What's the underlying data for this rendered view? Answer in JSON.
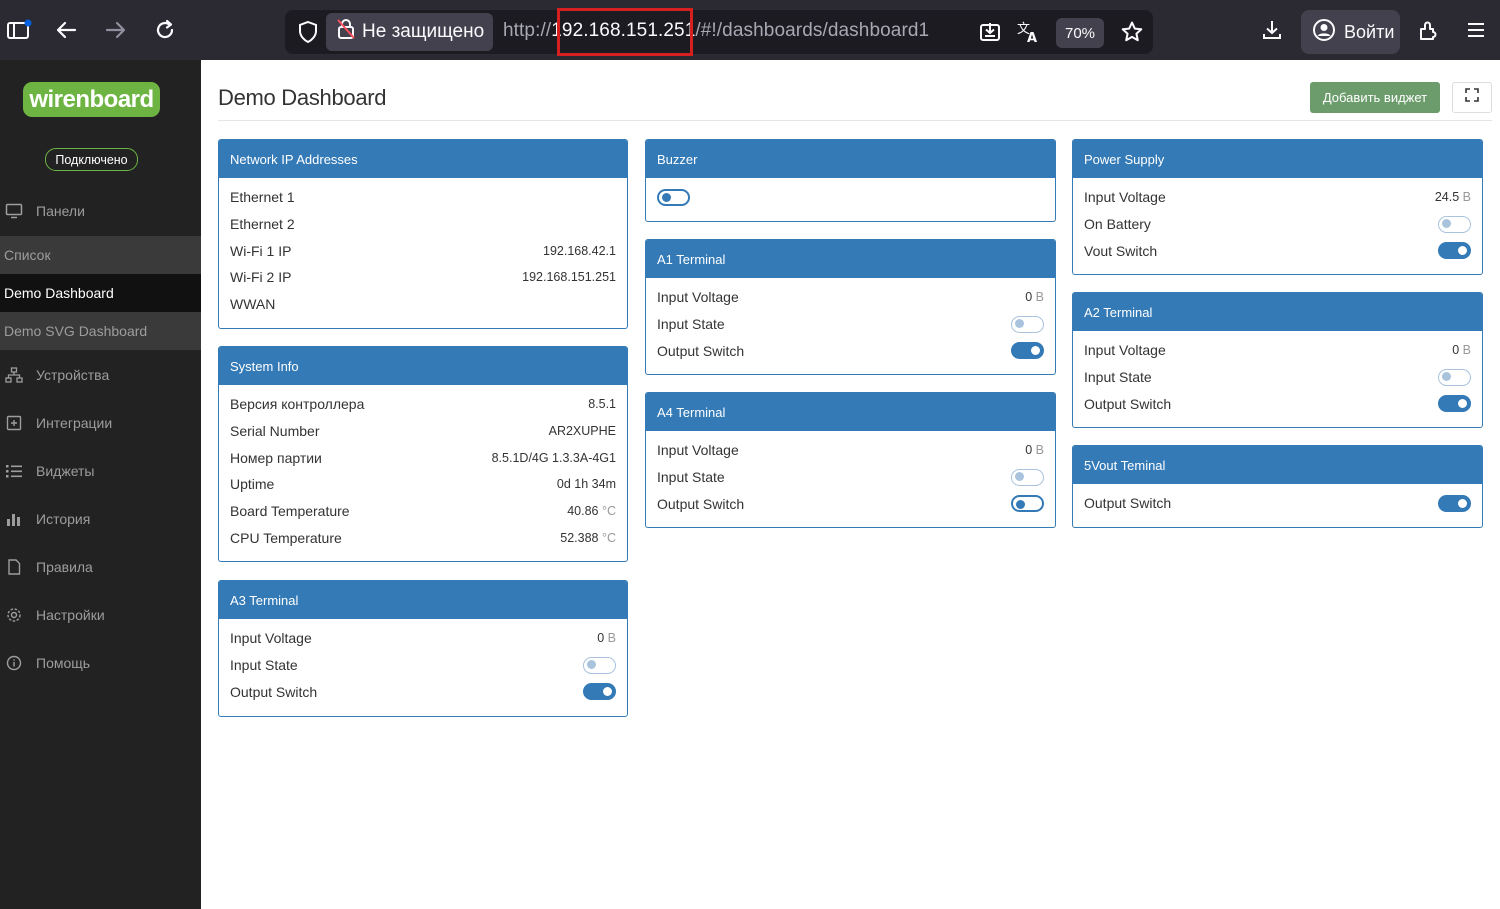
{
  "browser": {
    "security_label": "Не защищено",
    "url_prefix": "http://",
    "url_host": "192.168.151.251",
    "url_path": "/#!/dashboards/dashboard1",
    "zoom": "70%",
    "login_label": "Войти"
  },
  "sidebar": {
    "logo": "wirenboard",
    "status": "Подключено",
    "panels_label": "Панели",
    "sub_items": [
      "Список",
      "Demo Dashboard",
      "Demo SVG Dashboard"
    ],
    "items": [
      {
        "label": "Устройства",
        "icon": "devices-icon"
      },
      {
        "label": "Интеграции",
        "icon": "integrations-icon"
      },
      {
        "label": "Виджеты",
        "icon": "list-icon"
      },
      {
        "label": "История",
        "icon": "bar-chart-icon"
      },
      {
        "label": "Правила",
        "icon": "document-icon"
      },
      {
        "label": "Настройки",
        "icon": "gear-icon"
      },
      {
        "label": "Помощь",
        "icon": "info-icon"
      }
    ]
  },
  "main": {
    "title": "Demo Dashboard",
    "add_widget": "Добавить виджет"
  },
  "widgets": {
    "network": {
      "title": "Network IP Addresses",
      "rows": [
        {
          "label": "Ethernet 1",
          "value": ""
        },
        {
          "label": "Ethernet 2",
          "value": ""
        },
        {
          "label": "Wi-Fi 1 IP",
          "value": "192.168.42.1"
        },
        {
          "label": "Wi-Fi 2 IP",
          "value": "192.168.151.251"
        },
        {
          "label": "WWAN",
          "value": ""
        }
      ]
    },
    "system": {
      "title": "System Info",
      "rows": [
        {
          "label": "Версия контроллера",
          "value": "8.5.1",
          "unit": ""
        },
        {
          "label": "Serial Number",
          "value": "AR2XUPHE",
          "unit": ""
        },
        {
          "label": "Номер партии",
          "value": "8.5.1D/4G 1.3.3A-4G1",
          "unit": ""
        },
        {
          "label": "Uptime",
          "value": "0d 1h 34m",
          "unit": ""
        },
        {
          "label": "Board Temperature",
          "value": "40.86",
          "unit": "°C"
        },
        {
          "label": "CPU Temperature",
          "value": "52.388",
          "unit": "°C"
        }
      ]
    },
    "a3": {
      "title": "A3 Terminal",
      "voltage_label": "Input Voltage",
      "voltage": "0",
      "unit": "B",
      "state_label": "Input State",
      "state_on": false,
      "switch_label": "Output Switch",
      "switch_on": true
    },
    "buzzer": {
      "title": "Buzzer",
      "on": false
    },
    "a1": {
      "title": "A1 Terminal",
      "voltage_label": "Input Voltage",
      "voltage": "0",
      "unit": "B",
      "state_label": "Input State",
      "state_on": false,
      "switch_label": "Output Switch",
      "switch_on": true
    },
    "a4": {
      "title": "A4 Terminal",
      "voltage_label": "Input Voltage",
      "voltage": "0",
      "unit": "B",
      "state_label": "Input State",
      "state_on": false,
      "switch_label": "Output Switch",
      "switch_on": false
    },
    "power": {
      "title": "Power Supply",
      "voltage_label": "Input Voltage",
      "voltage": "24.5",
      "unit": "B",
      "battery_label": "On Battery",
      "battery_on": false,
      "vout_label": "Vout Switch",
      "vout_on": true
    },
    "a2": {
      "title": "A2 Terminal",
      "voltage_label": "Input Voltage",
      "voltage": "0",
      "unit": "B",
      "state_label": "Input State",
      "state_on": false,
      "switch_label": "Output Switch",
      "switch_on": true
    },
    "fivevout": {
      "title": "5Vout Teminal",
      "switch_label": "Output Switch",
      "switch_on": true
    }
  },
  "colors": {
    "accent": "#337ab7",
    "logo": "#6eb443",
    "add_button": "#6c9c6c",
    "highlight": "#d61f1f"
  }
}
